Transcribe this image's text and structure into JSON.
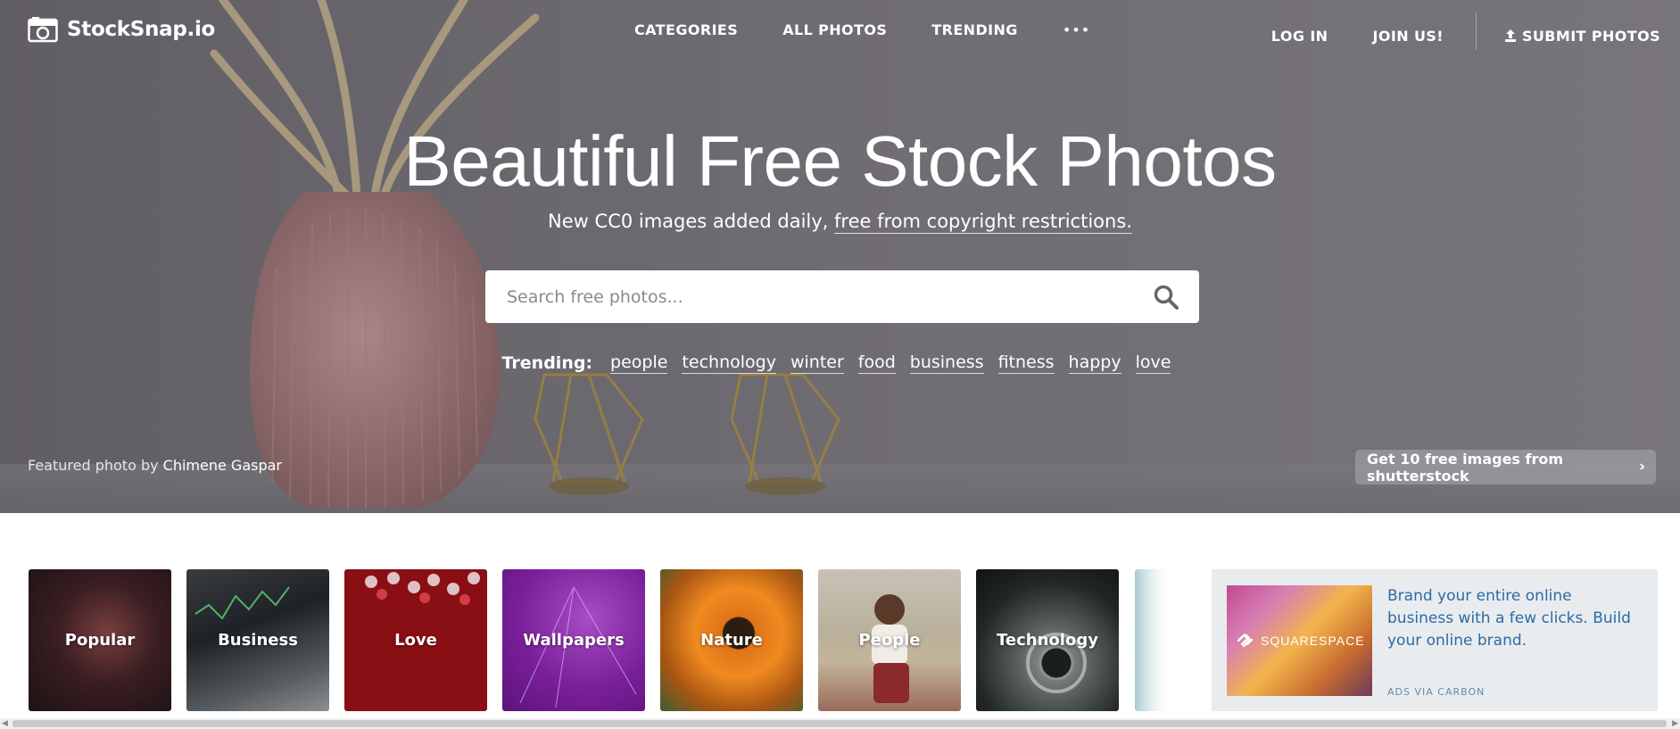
{
  "brand": {
    "name": "StockSnap.io"
  },
  "nav": {
    "center": [
      "CATEGORIES",
      "ALL PHOTOS",
      "TRENDING"
    ],
    "more": "•••",
    "login": "LOG IN",
    "join": "JOIN US!",
    "submit": "SUBMIT PHOTOS"
  },
  "hero": {
    "headline": "Beautiful Free Stock Photos",
    "sub_prefix": "New CC0 images added daily, ",
    "sub_link": "free from copyright restrictions.",
    "search_placeholder": "Search free photos...",
    "trending_label": "Trending:",
    "trending_tags": [
      "people",
      "technology",
      "winter",
      "food",
      "business",
      "fitness",
      "happy",
      "love"
    ],
    "featured_prefix": "Featured photo by ",
    "featured_author": "Chimene Gaspar",
    "shutterstock_cta": "Get 10 free images from shutterstock"
  },
  "categories": [
    "Popular",
    "Business",
    "Love",
    "Wallpapers",
    "Nature",
    "People",
    "Technology"
  ],
  "ad": {
    "brand": "SQUARESPACE",
    "text": "Brand your entire online business with a few clicks. Build your online brand.",
    "via": "ADS VIA CARBON"
  },
  "colors": {
    "ad_link": "#2d6aa3",
    "ad_bg": "#e8ecef"
  }
}
